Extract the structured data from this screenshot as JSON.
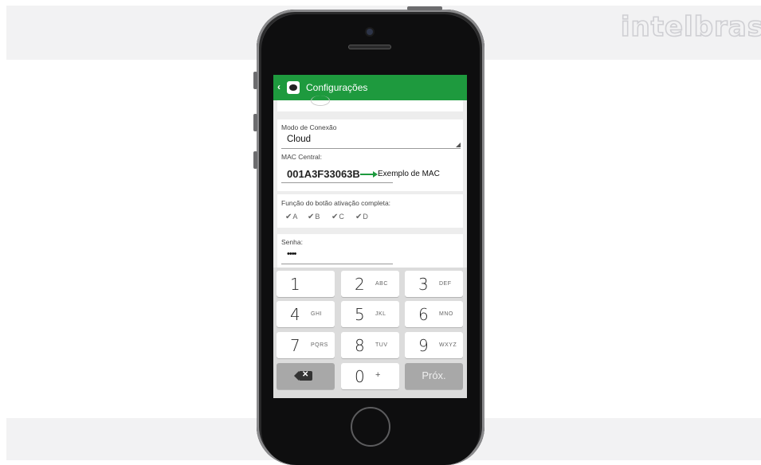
{
  "brand": "intelbras",
  "app": {
    "title": "Configurações",
    "back_icon": "chevron-left-icon"
  },
  "form": {
    "connection_mode_label": "Modo de Conexão",
    "connection_mode_value": "Cloud",
    "mac_label": "MAC Central:",
    "mac_value": "001A3F33063B",
    "mac_example_note": "Exemplo de MAC",
    "button_function_label": "Função do botão ativação completa:",
    "checkboxes": [
      {
        "label": "A",
        "checked": true
      },
      {
        "label": "B",
        "checked": true
      },
      {
        "label": "C",
        "checked": true
      },
      {
        "label": "D",
        "checked": true
      }
    ],
    "password_label": "Senha:",
    "password_value": "••••"
  },
  "keypad": {
    "keys": [
      {
        "num": "1",
        "letters": ""
      },
      {
        "num": "2",
        "letters": "ABC"
      },
      {
        "num": "3",
        "letters": "DEF"
      },
      {
        "num": "4",
        "letters": "GHI"
      },
      {
        "num": "5",
        "letters": "JKL"
      },
      {
        "num": "6",
        "letters": "MNO"
      },
      {
        "num": "7",
        "letters": "PQRS"
      },
      {
        "num": "8",
        "letters": "TUV"
      },
      {
        "num": "9",
        "letters": "WXYZ"
      },
      {
        "num": "0",
        "letters": "+"
      }
    ],
    "backspace_icon": "backspace-icon",
    "next_label": "Próx."
  },
  "colors": {
    "accent_green": "#1e9a3e",
    "phone_body": "#3a3a3c",
    "keypad_bg": "#dcdcdc"
  }
}
